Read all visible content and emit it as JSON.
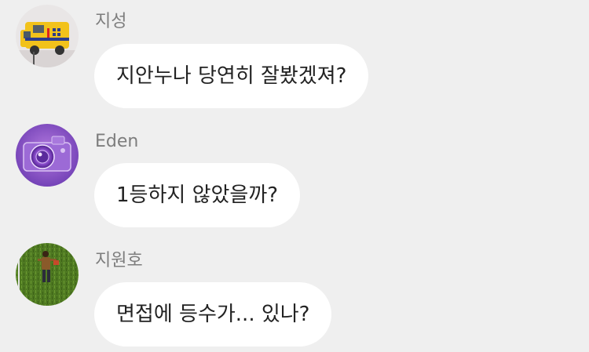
{
  "chat": {
    "messages": [
      {
        "sender": "지성",
        "text": "지안누나 당연히 잘봤겠져?",
        "avatar_icon": "ambulance-toy-icon"
      },
      {
        "sender": "Eden",
        "text": "1등하지 않았을까?",
        "avatar_icon": "camera-icon"
      },
      {
        "sender": "지원호",
        "text": "면접에 등수가... 있나?",
        "avatar_icon": "person-on-grass-icon"
      }
    ]
  },
  "colors": {
    "background": "#efefef",
    "bubble": "#ffffff",
    "sender_name": "#7d7d7d",
    "message_text": "#222222"
  }
}
